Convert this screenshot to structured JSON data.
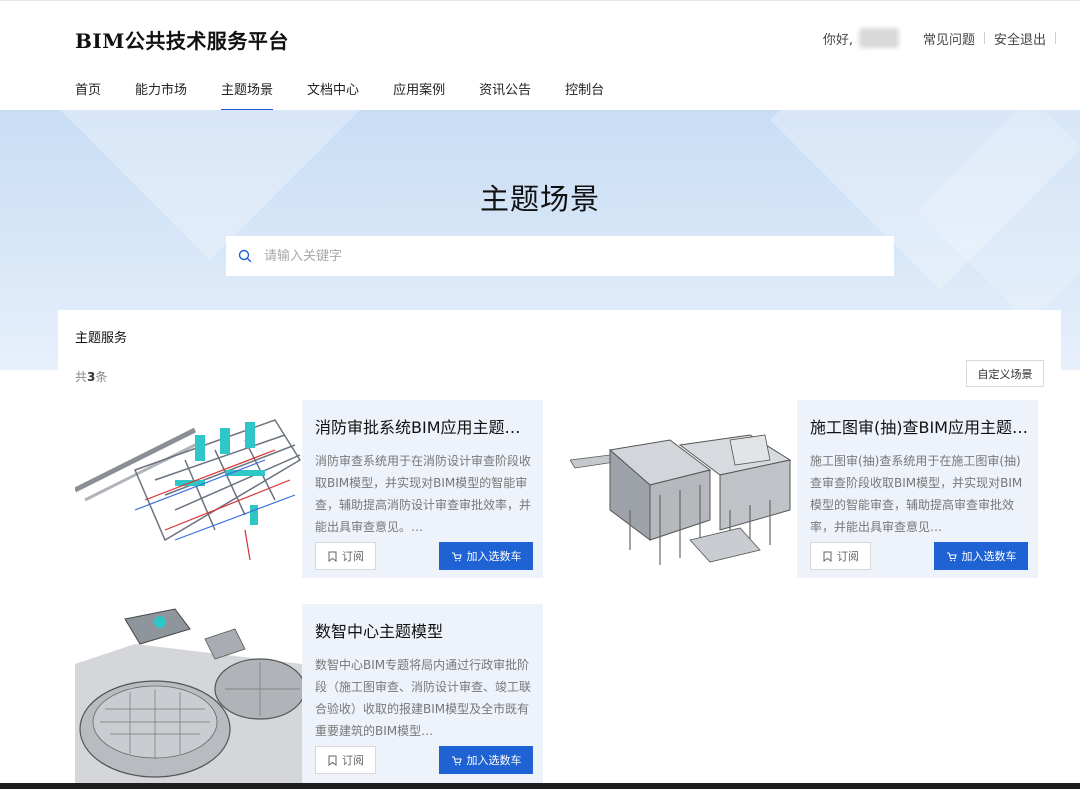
{
  "header": {
    "logo": "BIM公共技术服务平台",
    "greeting": "你好,",
    "links": {
      "faq": "常见问题",
      "logout": "安全退出"
    }
  },
  "nav": [
    {
      "label": "首页",
      "active": false
    },
    {
      "label": "能力市场",
      "active": false
    },
    {
      "label": "主题场景",
      "active": true
    },
    {
      "label": "文档中心",
      "active": false
    },
    {
      "label": "应用案例",
      "active": false
    },
    {
      "label": "资讯公告",
      "active": false
    },
    {
      "label": "控制台",
      "active": false
    }
  ],
  "banner": {
    "title": "主题场景",
    "search_placeholder": "请输入关键字"
  },
  "panel": {
    "section_title": "主题服务",
    "count_prefix": "共",
    "count": "3",
    "count_suffix": "条",
    "custom_button": "自定义场景"
  },
  "cards": [
    {
      "title": "消防审批系统BIM应用主题场景",
      "desc": "消防审查系统用于在消防设计审查阶段收取BIM模型，并实现对BIM模型的智能审查，辅助提高消防设计审查审批效率，并能出具审查意见。…",
      "subscribe": "订阅",
      "cart": "加入选数车"
    },
    {
      "title": "施工图审(抽)查BIM应用主题场景",
      "desc": "施工图审(抽)查系统用于在施工图审(抽)查审查阶段收取BIM模型，并实现对BIM模型的智能审查，辅助提高审查审批效率，并能出具审查意见…",
      "subscribe": "订阅",
      "cart": "加入选数车"
    },
    {
      "title": "数智中心主题模型",
      "desc": "数智中心BIM专题将局内通过行政审批阶段（施工图审查、消防设计审查、竣工联合验收）收取的报建BIM模型及全市既有重要建筑的BIM模型…",
      "subscribe": "订阅",
      "cart": "加入选数车"
    }
  ],
  "colors": {
    "accent": "#1e62d3",
    "nav_underline": "#1e5bd6",
    "card_bg": "#eef3fb",
    "banner_top": "#c9ddf5"
  },
  "icons": {
    "search": "search-icon",
    "subscribe": "bookmark-icon",
    "cart": "cart-icon"
  }
}
